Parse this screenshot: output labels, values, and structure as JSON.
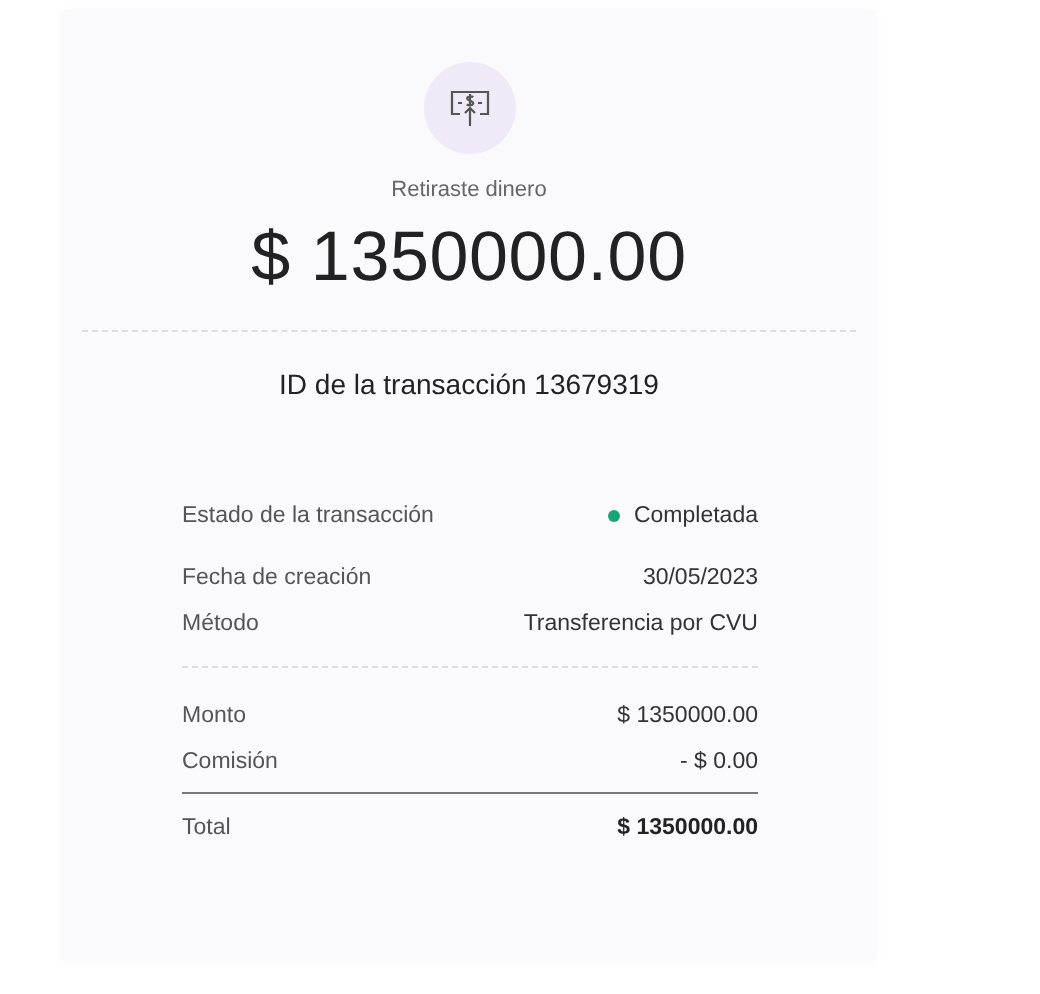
{
  "header": {
    "title": "Retiraste dinero",
    "amount": "$ 1350000.00"
  },
  "transaction_id": "ID de la transacción 13679319",
  "details": [
    {
      "label": "Estado de la transacción",
      "value": "Completada",
      "kind": "status",
      "color": "#1aa374"
    },
    {
      "label": "Fecha de creación",
      "value": "30/05/2023",
      "kind": "plain"
    },
    {
      "label": "Método",
      "value": "Transferencia por CVU",
      "kind": "plain"
    }
  ],
  "charges": [
    {
      "label": "Monto",
      "value": "$ 1350000.00"
    },
    {
      "label": "Comisión",
      "value": "- $ 0.00"
    }
  ],
  "total": {
    "label": "Total",
    "value": "$ 1350000.00"
  }
}
